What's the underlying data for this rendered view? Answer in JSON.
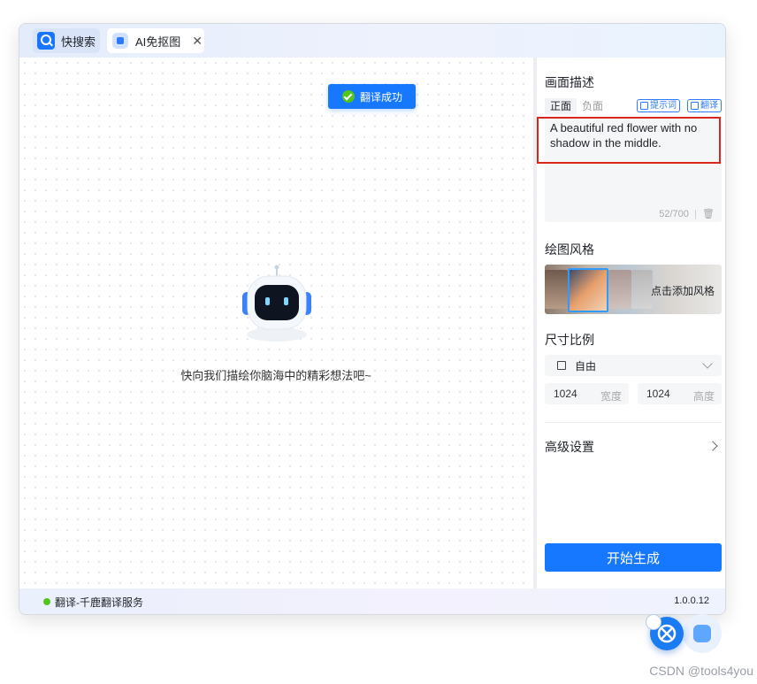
{
  "tabs": {
    "search_label": "快搜索",
    "ai_label": "AI免抠图",
    "close_glyph": "✕"
  },
  "canvas": {
    "toast_text": "翻译成功",
    "robot_hint": "快向我们描绘你脑海中的精彩想法吧~"
  },
  "panel": {
    "description_title": "画面描述",
    "tab_positive": "正面",
    "tab_negative": "负面",
    "btn_prompt_words": "提示词",
    "btn_translate": "翻译",
    "prompt_text": "A beautiful red flower with no shadow in the middle.",
    "prompt_counter": "52/700",
    "style_title": "绘图风格",
    "style_add": "点击添加风格",
    "ratio_title": "尺寸比例",
    "ratio_value": "自由",
    "width_value": "1024",
    "width_label": "宽度",
    "height_value": "1024",
    "height_label": "高度",
    "advanced_label": "高级设置",
    "generate_button": "开始生成"
  },
  "status": {
    "service": "翻译-千鹿翻译服务",
    "version": "1.0.0.12"
  },
  "watermark": "CSDN @tools4you",
  "colors": {
    "accent": "#1677ff",
    "status_ok": "#52c41a",
    "highlight": "#d9261c"
  }
}
